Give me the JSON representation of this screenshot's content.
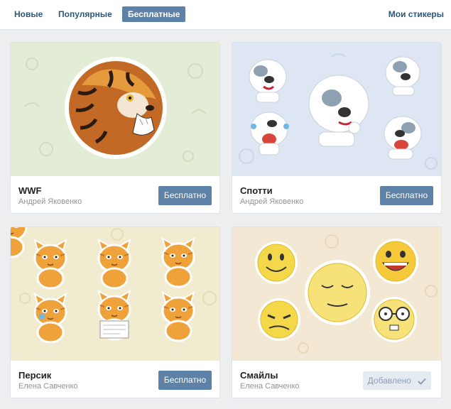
{
  "tabs": [
    {
      "label": "Новые",
      "active": false
    },
    {
      "label": "Популярные",
      "active": false
    },
    {
      "label": "Бесплатные",
      "active": true
    }
  ],
  "my_stickers_label": "Мои стикеры",
  "colors": {
    "accent": "#5e81a8",
    "link": "#2b587a",
    "page_bg": "#edeef0",
    "added_bg": "#e5ebf1"
  },
  "cards": [
    {
      "title": "WWF",
      "author": "Андрей Яковенко",
      "button": "Бесплатно",
      "art": "tiger-sticker",
      "bg": "#e3edd6"
    },
    {
      "title": "Спотти",
      "author": "Андрей Яковенко",
      "button": "Бесплатно",
      "art": "dog-stickers",
      "bg": "#dde6f2"
    },
    {
      "title": "Персик",
      "author": "Елена Савченко",
      "button": "Бесплатно",
      "art": "cat-stickers",
      "bg": "#f1ebcf"
    },
    {
      "title": "Смайлы",
      "author": "Елена Савченко",
      "button": "Добавлено",
      "button_icon": "checkmark-icon",
      "art": "smiley-stickers",
      "bg": "#f2e8d4"
    }
  ]
}
